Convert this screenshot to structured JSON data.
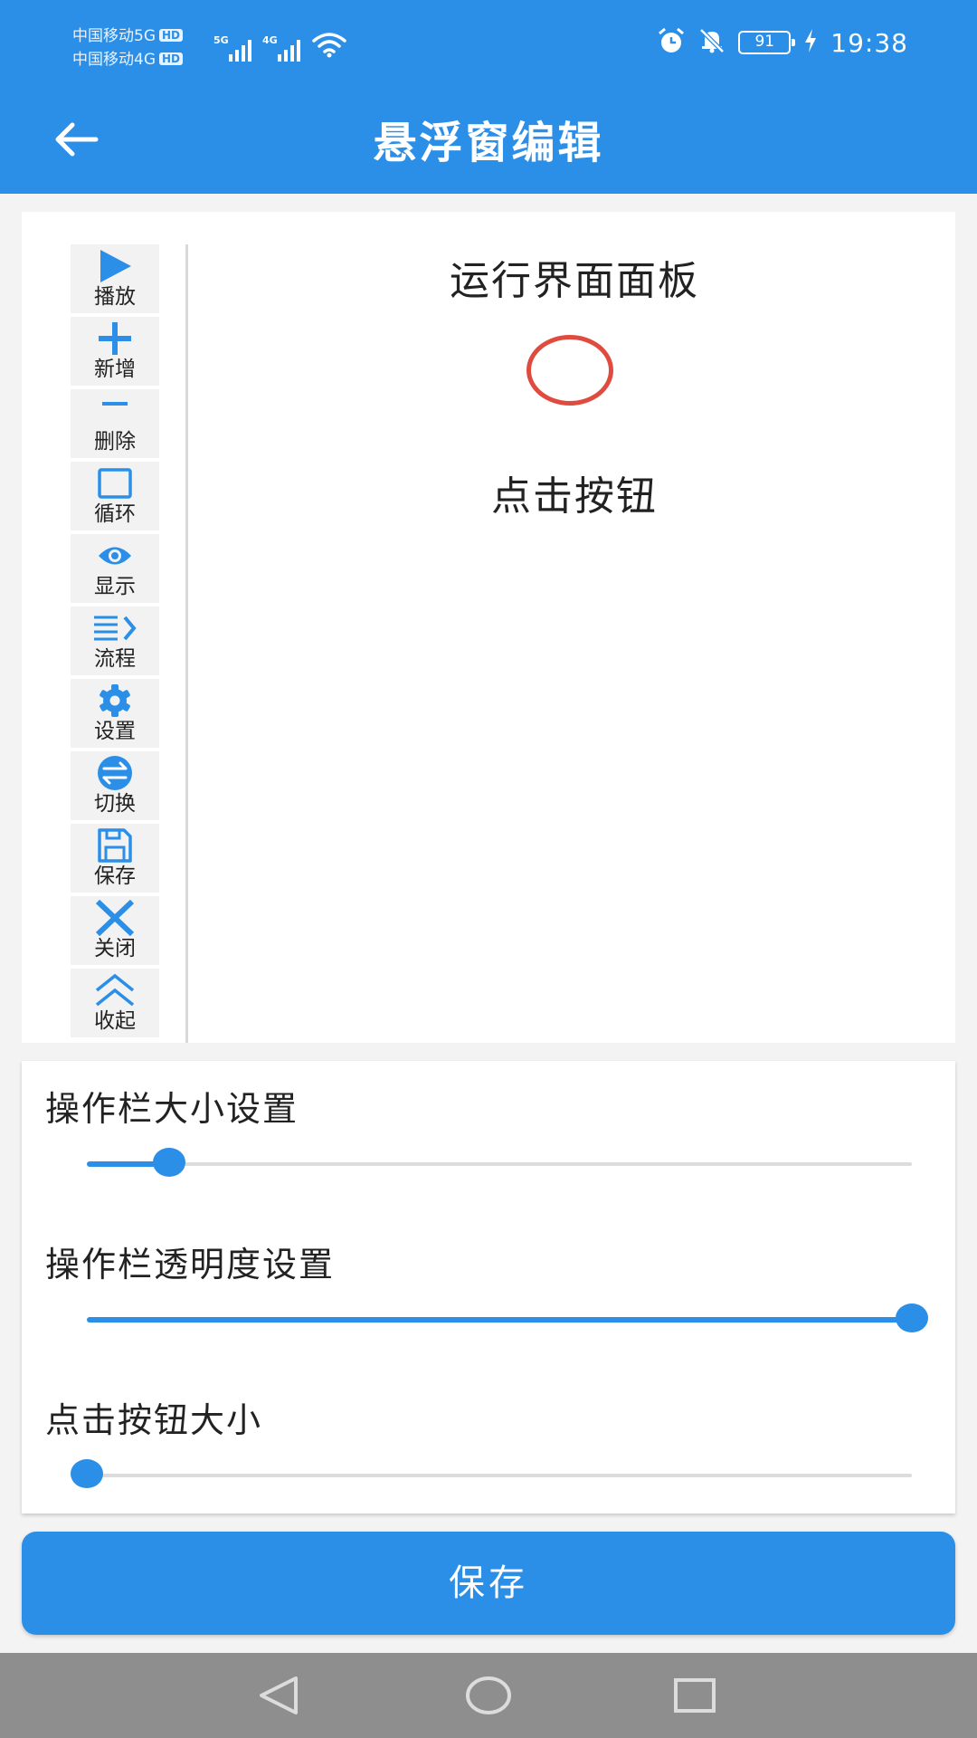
{
  "status_bar": {
    "carrier_1": "中国移动5G",
    "carrier_2": "中国移动4G",
    "hd_badge": "HD",
    "network_1": "5G",
    "network_2": "4G",
    "battery": "91",
    "time": "19:38",
    "icons": [
      "alarm-icon",
      "mute-bell-icon",
      "battery-icon",
      "charging-icon",
      "wifi-icon",
      "signal-icon"
    ]
  },
  "app_bar": {
    "title": "悬浮窗编辑",
    "back_icon": "arrow-left-icon"
  },
  "preview_panel": {
    "title": "运行界面面板",
    "click_button_label": "点击按钮",
    "tools": [
      {
        "label": "播放",
        "icon": "play-icon"
      },
      {
        "label": "新增",
        "icon": "plus-icon"
      },
      {
        "label": "删除",
        "icon": "minus-icon"
      },
      {
        "label": "循环",
        "icon": "square-icon"
      },
      {
        "label": "显示",
        "icon": "eye-icon"
      },
      {
        "label": "流程",
        "icon": "list-flow-icon"
      },
      {
        "label": "设置",
        "icon": "gear-icon"
      },
      {
        "label": "切换",
        "icon": "switch-icon"
      },
      {
        "label": "保存",
        "icon": "save-icon"
      },
      {
        "label": "关闭",
        "icon": "close-icon"
      },
      {
        "label": "收起",
        "icon": "collapse-up-icon"
      }
    ]
  },
  "settings": {
    "toolbar_size": {
      "label": "操作栏大小设置",
      "value": 0.1
    },
    "toolbar_opacity": {
      "label": "操作栏透明度设置",
      "value": 1.0
    },
    "click_button_size": {
      "label": "点击按钮大小",
      "value": 0.0
    }
  },
  "save_button": {
    "label": "保存"
  },
  "colors": {
    "primary": "#2b8fe8",
    "target_circle": "#e04b3f",
    "nav_bar": "#8e8e8e"
  }
}
